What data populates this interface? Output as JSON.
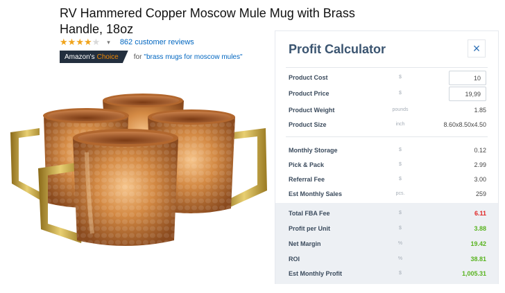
{
  "product": {
    "title": "RV Hammered Copper Moscow Mule Mug with Brass Handle, 18oz",
    "rating_stars": 4,
    "reviews_text": "862 customer reviews",
    "badge_prefix": "Amazon's",
    "badge_accent": "Choice",
    "badge_for": "for",
    "badge_query": "\"brass mugs for moscow mules\""
  },
  "calculator": {
    "title": "Profit Calculator",
    "close_icon": "×",
    "inputs": [
      {
        "label": "Product Cost",
        "unit": "$",
        "value": "10"
      },
      {
        "label": "Product Price",
        "unit": "$",
        "value": "19,99"
      }
    ],
    "details": [
      {
        "label": "Product Weight",
        "unit": "pounds",
        "value": "1.85"
      },
      {
        "label": "Product Size",
        "unit": "inch",
        "value": "8.60x8.50x4.50"
      }
    ],
    "fees": [
      {
        "label": "Monthly Storage",
        "unit": "$",
        "value": "0.12"
      },
      {
        "label": "Pick & Pack",
        "unit": "$",
        "value": "2.99"
      },
      {
        "label": "Referral Fee",
        "unit": "$",
        "value": "3.00"
      },
      {
        "label": "Est Monthly Sales",
        "unit": "pcs.",
        "value": "259"
      }
    ],
    "results": [
      {
        "label": "Total FBA Fee",
        "unit": "$",
        "value": "6.11",
        "color": "#e02424"
      },
      {
        "label": "Profit per Unit",
        "unit": "$",
        "value": "3.88",
        "color": "#58b31f"
      },
      {
        "label": "Net Margin",
        "unit": "%",
        "value": "19.42",
        "color": "#58b31f"
      },
      {
        "label": "ROI",
        "unit": "%",
        "value": "38.81",
        "color": "#58b31f"
      },
      {
        "label": "Est Monthly Profit",
        "unit": "$",
        "value": "1,005.31",
        "color": "#58b31f"
      }
    ]
  },
  "colors": {
    "brand_dark": "#232f3e",
    "choice_orange": "#f08804",
    "link_blue": "#0066c0",
    "star_gold": "#f0a41c",
    "calc_title": "#3a5470",
    "negative_red": "#e02424",
    "positive_green": "#58b31f"
  },
  "icons": {
    "close": "close-icon",
    "rating_dropdown": "chevron-down-icon",
    "star": "star-icon"
  }
}
